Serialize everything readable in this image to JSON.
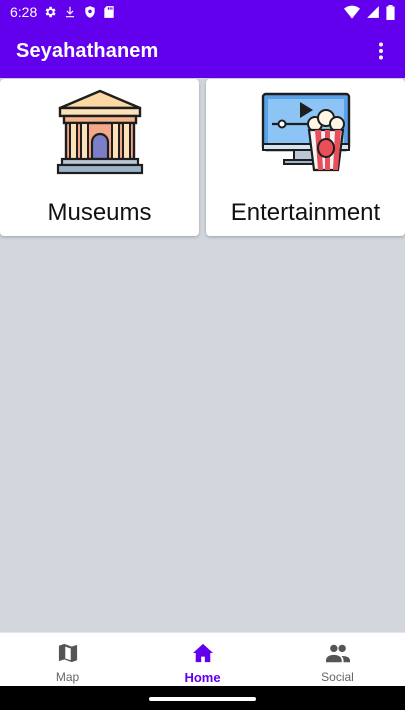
{
  "status_bar": {
    "time": "6:28",
    "icons": [
      "gear-icon",
      "download-icon",
      "shield-icon",
      "sd-card-icon",
      "wifi-icon",
      "signal-icon",
      "battery-icon"
    ]
  },
  "app_bar": {
    "title": "Seyahathanem",
    "overflow_icon": "more-vert-icon",
    "color": "#6200ee"
  },
  "categories": [
    {
      "label": "Museums",
      "icon": "museum-icon"
    },
    {
      "label": "Entertainment",
      "icon": "entertainment-icon"
    }
  ],
  "bottom_nav": {
    "items": [
      {
        "label": "Map",
        "icon": "map-icon",
        "active": false
      },
      {
        "label": "Home",
        "icon": "home-icon",
        "active": true
      },
      {
        "label": "Social",
        "icon": "social-icon",
        "active": false
      }
    ],
    "active_color": "#6200ee"
  }
}
